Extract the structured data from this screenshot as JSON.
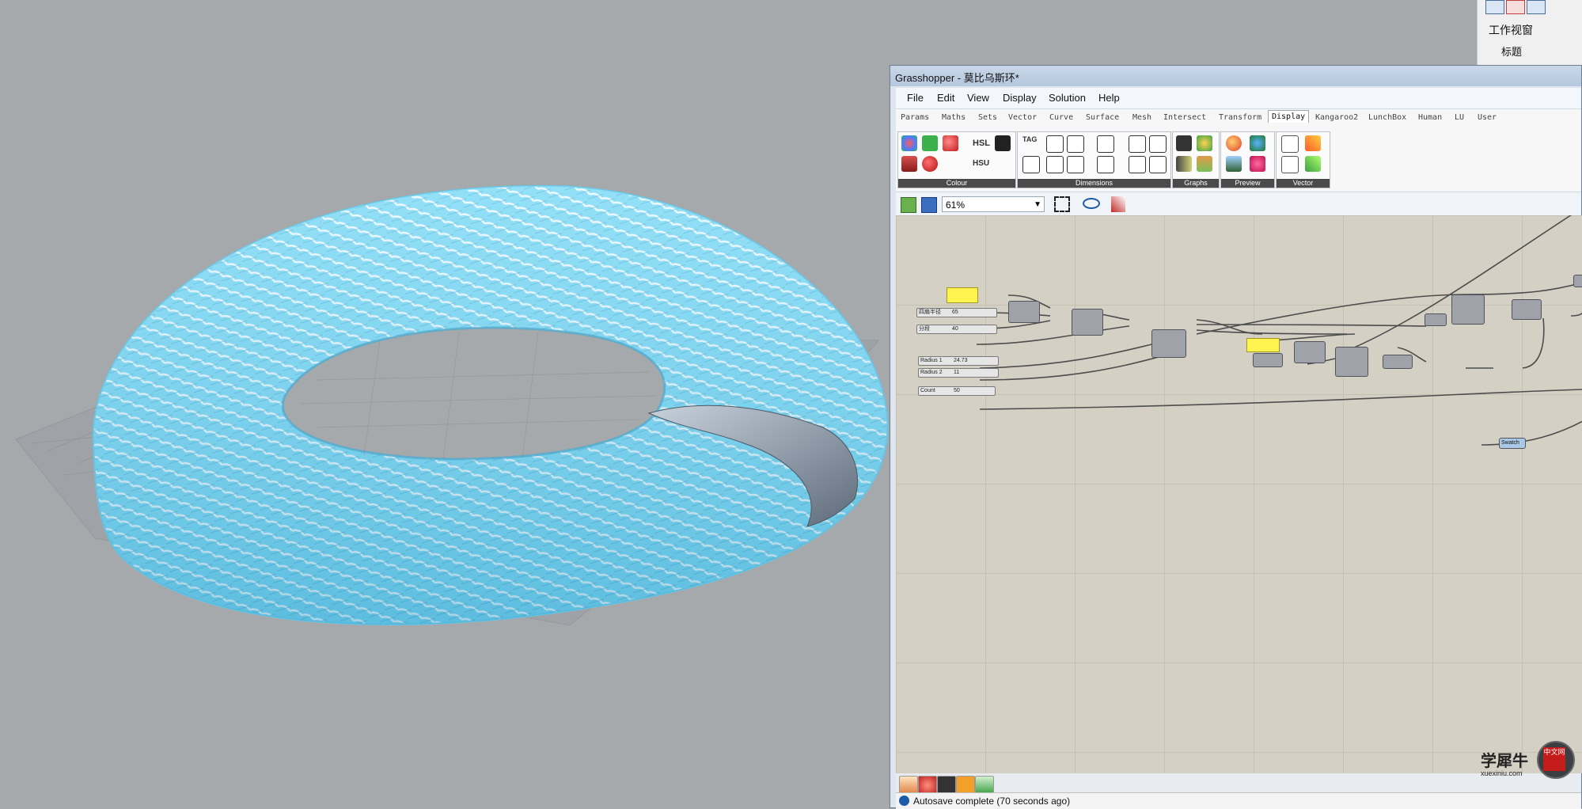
{
  "rhino_panel": {
    "workview_label": "工作视窗",
    "title_label": "标题"
  },
  "gh": {
    "window_title": "Grasshopper - 莫比乌斯环*",
    "menu": [
      "File",
      "Edit",
      "View",
      "Display",
      "Solution",
      "Help"
    ],
    "tabs": [
      "Params",
      "Maths",
      "Sets",
      "Vector",
      "Curve",
      "Surface",
      "Mesh",
      "Intersect",
      "Transform",
      "Display",
      "Kangaroo2",
      "LunchBox",
      "Human",
      "LU",
      "User"
    ],
    "active_tab": "Display",
    "ribbon_groups": [
      "Colour",
      "Dimensions",
      "Graphs",
      "Preview",
      "Vector"
    ],
    "ribbon_text": {
      "hsl": "HSL",
      "hsu": "HSU",
      "tag": "TAG"
    },
    "zoom": "61%",
    "sliders": [
      {
        "label": "四扇半径",
        "value": "65"
      },
      {
        "label": "分段",
        "value": "40"
      },
      {
        "label": "Radius 1",
        "value": "24.73"
      },
      {
        "label": "Radius 2",
        "value": "11"
      },
      {
        "label": "Count",
        "value": "50"
      }
    ],
    "swatch_label": "Swatch",
    "status_text": "Autosave complete (70 seconds ago)"
  },
  "watermark": {
    "big": "学犀牛",
    "small": "xuexiniu.com",
    "badge": "中文网"
  },
  "colors": {
    "viewport_bg": "#a6a9ac",
    "mesh_cyan": "#6fd6f5",
    "canvas_bg": "#d4d0c4",
    "node_grey": "#9fa3a9",
    "panel_yellow": "#fff44f"
  }
}
